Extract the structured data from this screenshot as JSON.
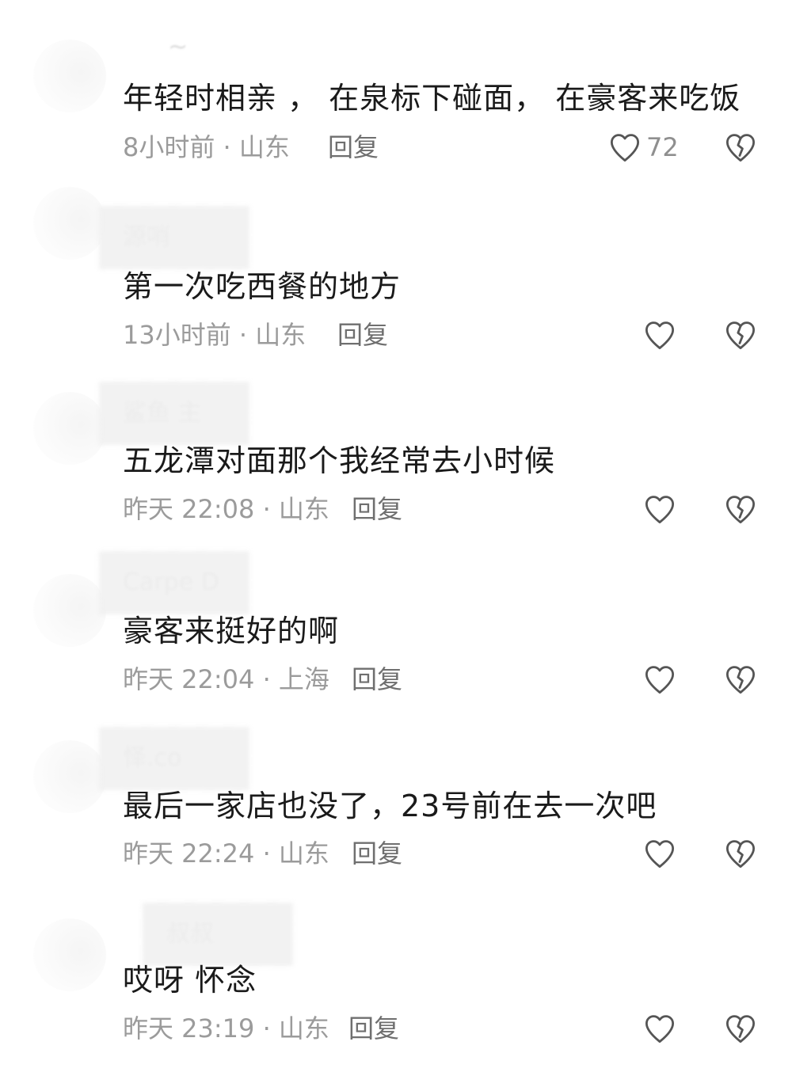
{
  "top_fragment": "~",
  "comments": [
    {
      "username": "",
      "text": "年轻时相亲 ， 在泉标下碰面， 在豪客来吃饭",
      "time_location": "8小时前 · 山东",
      "reply_label": "回复",
      "like_count": "72"
    },
    {
      "username": "源哨",
      "text": "第一次吃西餐的地方",
      "time_location": "13小时前 · 山东",
      "reply_label": "回复",
      "like_count": ""
    },
    {
      "username": "鲨鱼 主",
      "text": "五龙潭对面那个我经常去小时候",
      "time_location": "昨天 22:08 · 山东",
      "reply_label": "回复",
      "like_count": ""
    },
    {
      "username": "Carpe D",
      "text": "豪客来挺好的啊",
      "time_location": "昨天 22:04 · 上海",
      "reply_label": "回复",
      "like_count": ""
    },
    {
      "username": "怿.co",
      "text": "最后一家店也没了，23号前在去一次吧",
      "time_location": "昨天 22:24 · 山东",
      "reply_label": "回复",
      "like_count": ""
    },
    {
      "username": "叔叔",
      "text": "哎呀 怀念",
      "time_location": "昨天 23:19 · 山东",
      "reply_label": "回复",
      "like_count": ""
    }
  ],
  "icons": {
    "like": "heart-outline-icon",
    "dislike": "broken-heart-icon"
  },
  "colors": {
    "text": "#1a1a1a",
    "meta": "#9b9b9b",
    "reply": "#6f6f6f",
    "icon": "#555555"
  }
}
